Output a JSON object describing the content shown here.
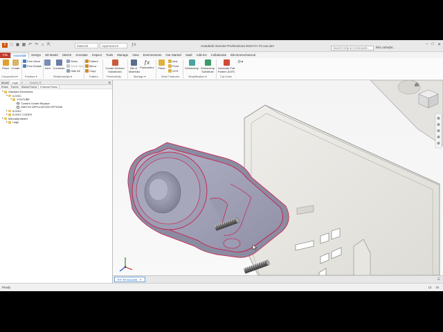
{
  "app": {
    "title": "Autodesk Inventor Professional 2023   FA-T2-xxx.iam",
    "material": "Material",
    "appearance": "Appearance",
    "search_placeholder": "Search Help & Commands...",
    "user": "felix.corba(M..."
  },
  "menu_tabs": [
    "File",
    "Assemble",
    "Design",
    "3D Model",
    "Sketch",
    "Annotate",
    "Inspect",
    "Tools",
    "Manage",
    "View",
    "Environments",
    "Get Started",
    "Vault",
    "Add-Ins",
    "Collaborate",
    "Electromechanical"
  ],
  "ribbon": {
    "component": {
      "place": "Place",
      "create": "Create",
      "label": "Component ▾"
    },
    "position": {
      "free_move": "Free Move",
      "free_rotate": "Free Rotate",
      "label": "Position ▾"
    },
    "relationships": {
      "joint": "Joint",
      "constrain": "Constrain",
      "show": "Show",
      "show_sick": "Show Sick",
      "hide_all": "Hide All",
      "label": "Relationships ▾"
    },
    "pattern": {
      "pattern": "Pattern",
      "mirror": "Mirror",
      "copy": "Copy",
      "label": "Pattern"
    },
    "productivity": {
      "create_derived": "Create Derived",
      "substitutes": "Substitutes",
      "label": "Productivity"
    },
    "manage": {
      "bom": "Bill of",
      "bom2": "Materials",
      "parameters": "Parameters",
      "label": "Manage ▾"
    },
    "work_features": {
      "plane": "Plane",
      "axis": "Axis",
      "point": "Point",
      "ucs": "UCS",
      "label": "Work Features"
    },
    "simplification": {
      "shrinkwrap": "Shrinkwrap",
      "shrinkwrap_sub": "Shrinkwrap",
      "shrinkwrap_sub2": "Substitute",
      "label": "Simplification ▾"
    },
    "cut_lines": {
      "generate": "Generate Flat",
      "generate2": "Pattern (DXF)",
      "label": "Cut Lines"
    }
  },
  "browser": {
    "tabs": [
      "Model",
      "Logic",
      "+"
    ],
    "search": "Search",
    "subtabs": [
      "Rules",
      "Forms",
      "Global Forms",
      "External Rules"
    ],
    "tree": [
      {
        "label": "Standard Directories",
        "level": 0,
        "twist": "▾",
        "kind": "folder"
      },
      {
        "label": "iLOGIC",
        "level": 1,
        "twist": "▾",
        "kind": "folder"
      },
      {
        "label": "YOUTUBE",
        "level": 2,
        "twist": "▾",
        "kind": "folder"
      },
      {
        "label": "Content Center Replace",
        "level": 3,
        "twist": "",
        "kind": "rule"
      },
      {
        "label": "SWITCH APPLICATION OPTIONS",
        "level": 3,
        "twist": "",
        "kind": "rule"
      },
      {
        "label": "ILOGIC",
        "level": 1,
        "twist": "▸",
        "kind": "folder"
      },
      {
        "label": "ILOGIC CODES",
        "level": 1,
        "twist": "▸",
        "kind": "folder"
      },
      {
        "label": "Manually Added",
        "level": 0,
        "twist": "▾",
        "kind": "folder"
      },
      {
        "label": "Logic",
        "level": 1,
        "twist": "▸",
        "kind": "folder"
      }
    ]
  },
  "document_tab": {
    "label": "FA-T2-xxx.iam",
    "close": "✕"
  },
  "status": {
    "text": "Ready",
    "num1": "12",
    "num2": "16"
  },
  "colors": {
    "part_body": "#9f9fb5",
    "part_edges": "#d40a3c",
    "frame": "#e6e5df",
    "accent": "#1a63b5"
  },
  "icons": [
    "home-icon",
    "viewcube-icon",
    "nav-bar-icon",
    "coordinate-triad-icon",
    "search-icon"
  ]
}
